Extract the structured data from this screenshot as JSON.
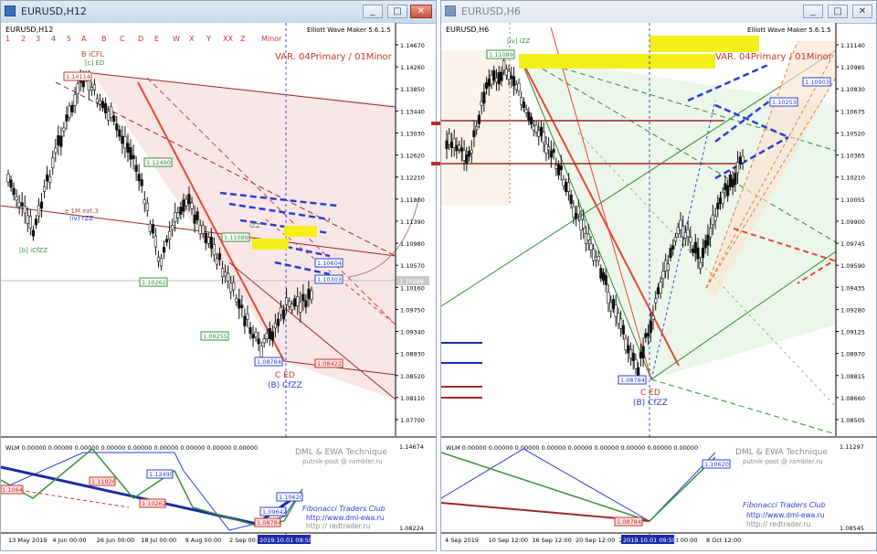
{
  "left": {
    "title": "EURUSD,H12",
    "chart_label": "EURUSD,H12",
    "ewm": "Elliott Wave Maker 5.6.1.5",
    "variant": "VAR. 04Primary / 01Minor",
    "wave_labels": [
      "1",
      "2",
      "3",
      "4",
      "5",
      "A",
      "B",
      "C",
      "D",
      "E",
      "W",
      "X",
      "Y",
      "XX",
      "Z",
      "Minor"
    ],
    "price_axis": [
      "1.14670",
      "1.14260",
      "1.13850",
      "1.13440",
      "1.13030",
      "1.12620",
      "1.12210",
      "1.11800",
      "1.11390",
      "1.10980",
      "1.10570",
      "1.10160",
      "1.09750",
      "1.09340",
      "1.08930",
      "1.08520",
      "1.08110",
      "1.07700"
    ],
    "price_tags": [
      "1.14114",
      "1.12490",
      "1.11089",
      "1.10262",
      "1.10604",
      "1.10303",
      "1.09255",
      "1.08784",
      "1.08422",
      "1.10288"
    ],
    "annotations": {
      "top_label": "B iCFL",
      "top_sub": "[c] ED",
      "c_ed": "C ED",
      "b_cfzz": "(B) CfZZ",
      "b_icfzz": "[b] iCfZZ",
      "e_ext": "e 1M ext.3",
      "iv_rzz": "(iv) rZZ",
      "izz": "iZZ"
    },
    "osc": {
      "label": "WLM 0.00000 0.00000 0.00000 0.00000 0.00000 0.00000 0.00000 0.00000 0.00000",
      "axis": [
        "1.14674",
        "1.08224"
      ],
      "tags": [
        "1.11926",
        "1.12490",
        "1.10262",
        "1.10620",
        "1.09642",
        "1.08784",
        "1.1064"
      ],
      "watermark1": "DML & EWA Technique",
      "watermark2": "putnik-post @ rambler.ru",
      "club": "Fibonacci Traders Club",
      "site1": "http://www.dml-ewa.ru",
      "site2": "http:// redtrader.ru"
    },
    "time_axis": [
      "13 May 2019",
      "4 Jun 00:00",
      "26 Jun 00:00",
      "18 Jul 00:00",
      "9 Aug 00:00",
      "2 Sep 00:00"
    ],
    "time_marker": "2019.10.01 09:59"
  },
  "right": {
    "title": "EURUSD,H6",
    "chart_label": "EURUSD,H6",
    "ewm": "Elliott Wave Maker 5.6.1.5",
    "variant": "VAR. 04Primary / 01Minor",
    "price_axis": [
      "1.11140",
      "1.10985",
      "1.10830",
      "1.10675",
      "1.10520",
      "1.10365",
      "1.10210",
      "1.10055",
      "1.09900",
      "1.09745",
      "1.09590",
      "1.09435",
      "1.09280",
      "1.09125",
      "1.08970",
      "1.08815",
      "1.08660",
      "1.08505"
    ],
    "price_tags": [
      "1.11089",
      "1.10903",
      "1.10253",
      "1.08784"
    ],
    "annotations": {
      "top_label": "[iv] iZZ",
      "c_ed": "C ED",
      "b_cfzz": "(B) CfZZ"
    },
    "osc": {
      "label": "WLM 0.00000 0.00000 0.00000 0.00000 0.00000 0.00000 0.00000 0.00000 0.00000",
      "axis": [
        "1.11297",
        "1.08545"
      ],
      "tags": [
        "1.10620",
        "1.08784"
      ],
      "watermark1": "DML & EWA Technique",
      "watermark2": "putnik-post @ rambler.ru",
      "club": "Fibonacci Traders Club",
      "site1": "http://www.dml-ewa.ru",
      "site2": "http:// redtrader.ru"
    },
    "time_axis": [
      "4 Sep 2019",
      "10 Sep 12:00",
      "16 Sep 12:00",
      "20 Sep 12:00",
      "26 Sep 12:00",
      "4 Oct 00:00",
      "8 Oct 12:00"
    ],
    "time_marker": "2019.10.01 09:59"
  },
  "buttons": {
    "minimize": "_",
    "maximize": "□",
    "close": "✕"
  }
}
